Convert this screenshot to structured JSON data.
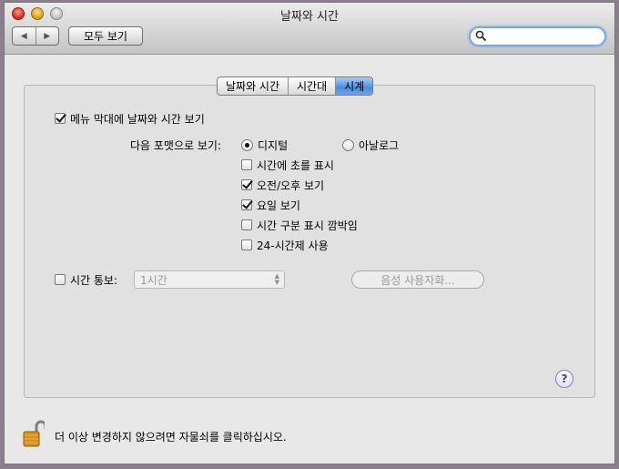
{
  "window": {
    "title": "날짜와 시간"
  },
  "toolbar": {
    "back_icon": "back-arrow",
    "forward_icon": "forward-arrow",
    "show_all_label": "모두 보기"
  },
  "search": {
    "value": "",
    "placeholder": ""
  },
  "tabs": [
    {
      "label": "날짜와 시간",
      "selected": false
    },
    {
      "label": "시간대",
      "selected": false
    },
    {
      "label": "시계",
      "selected": true
    }
  ],
  "clock": {
    "menubar_label": "메뉴 막대에 날짜와 시간 보기",
    "menubar_checked": true,
    "format_label": "다음 포맷으로 보기:",
    "format_digital": "디지털",
    "format_analog": "아날로그",
    "format_selected": "디지털",
    "options": [
      {
        "label": "시간에 초를 표시",
        "checked": false
      },
      {
        "label": "오전/오후 보기",
        "checked": true
      },
      {
        "label": "요일 보기",
        "checked": true
      },
      {
        "label": "시간 구분 표시 깜박임",
        "checked": false
      },
      {
        "label": "24-시간제 사용",
        "checked": false
      }
    ],
    "announce_label": "시간 통보:",
    "announce_checked": false,
    "announce_interval": "1시간",
    "voice_button": "음성 사용자화...",
    "help_label": "?"
  },
  "footer": {
    "lock_text": "더 이상 변경하지 않으려면 자물쇠를 클릭하십시오."
  },
  "colors": {
    "selected_tab": "#4b8ce0",
    "search_focus": "#7aa7e6"
  }
}
